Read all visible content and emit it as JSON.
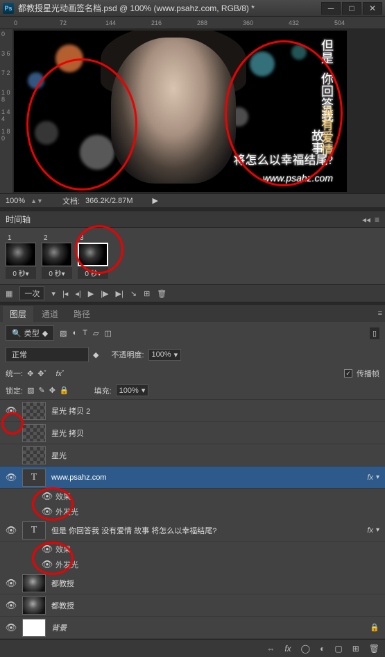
{
  "title": "都教授星光动画签名档.psd @ 100% (www.psahz.com, RGB/8) *",
  "ruler_h": [
    "0",
    "72",
    "144",
    "216",
    "288",
    "360",
    "432",
    "504"
  ],
  "ruler_v": [
    "0",
    "3 6",
    "7 2",
    "1 0 8",
    "1 4 4",
    "1 8 0"
  ],
  "canvas": {
    "text_lines": [
      "但是",
      "你回答我",
      "没有爱情",
      "故事",
      "将怎么以幸福结尾?"
    ],
    "url": "www.psahz.com"
  },
  "status": {
    "zoom": "100%",
    "doc_label": "文档:",
    "doc_info": "366.2K/2.87M"
  },
  "timeline": {
    "title": "时间轴",
    "frames": [
      {
        "n": "1",
        "t": "0 秒▾"
      },
      {
        "n": "2",
        "t": "0 秒▾"
      },
      {
        "n": "3",
        "t": "0 秒▾"
      }
    ],
    "loop": "一次"
  },
  "layers": {
    "tabs": [
      "图层",
      "通道",
      "路径"
    ],
    "kind": "类型",
    "blend": "正常",
    "opacity_label": "不透明度:",
    "opacity": "100%",
    "unify": "统一:",
    "propagate": "传播帧",
    "lock": "锁定:",
    "fill_label": "填充:",
    "fill": "100%",
    "items": [
      {
        "name": "星光 拷贝 2",
        "type": "checker",
        "eye": true
      },
      {
        "name": "星光 拷贝",
        "type": "checker",
        "eye": false
      },
      {
        "name": "星光",
        "type": "checker",
        "eye": false
      },
      {
        "name": "www.psahz.com",
        "type": "T",
        "eye": true,
        "sel": true,
        "fx": true,
        "sub": [
          "效果",
          "外发光"
        ]
      },
      {
        "name": "但是 你回答我 没有爱情 故事 将怎么以幸福结尾?",
        "type": "T",
        "eye": true,
        "fx": true,
        "sub": [
          "效果",
          "外发光"
        ]
      },
      {
        "name": "都教授",
        "type": "img",
        "eye": true
      },
      {
        "name": "都教授",
        "type": "img",
        "eye": true
      },
      {
        "name": "背景",
        "type": "white",
        "eye": true,
        "lock": true
      }
    ]
  }
}
